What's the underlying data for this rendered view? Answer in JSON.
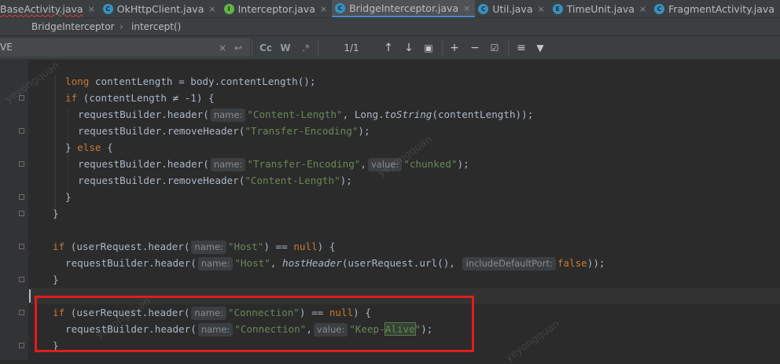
{
  "tabs": [
    {
      "name": "BaseActivity.java",
      "icon": "",
      "close": "×",
      "error": true
    },
    {
      "name": "OkHttpClient.java",
      "icon": "C",
      "iconColor": "#3592c4",
      "close": "×"
    },
    {
      "name": "Interceptor.java",
      "icon": "I",
      "iconColor": "#62b543",
      "close": "×"
    },
    {
      "name": "BridgeInterceptor.java",
      "icon": "C",
      "iconColor": "#3592c4",
      "close": "×",
      "active": true
    },
    {
      "name": "Util.java",
      "icon": "C",
      "iconColor": "#3592c4",
      "close": "×"
    },
    {
      "name": "TimeUnit.java",
      "icon": "E",
      "iconColor": "#3592c4",
      "close": "×"
    },
    {
      "name": "FragmentActivity.java",
      "icon": "C",
      "iconColor": "#3592c4",
      "close": "×"
    }
  ],
  "breadcrumb": {
    "class_name": "BridgeInterceptor",
    "separator": "›",
    "method": "intercept()"
  },
  "search": {
    "query": "VE",
    "clear_icon": "×",
    "history_icon": "↩",
    "match_case": "Cc",
    "whole_words": "W",
    "regex": ".*",
    "match_count": "1/1",
    "prev_icon": "↑",
    "next_icon": "↓",
    "select_all_icon": "▣",
    "add_occurrence_icon": "+",
    "remove_occurrence_icon": "−",
    "toggle_selection_icon": "☑",
    "multiline_icon": "≡",
    "filter_icon": "▼"
  },
  "code": {
    "l1": {
      "kw": "long",
      "rest": " contentLength = body.contentLength();"
    },
    "l2": {
      "kw": "if",
      "rest1": " (contentLength ≠ -1) {"
    },
    "l3": {
      "pre": "requestBuilder.header(",
      "hint": "name:",
      "str": "\"Content-Length\"",
      "mid": ", Long.",
      "fn": "toString",
      "post": "(contentLength));"
    },
    "l4": {
      "pre": "requestBuilder.removeHeader(",
      "str": "\"Transfer-Encoding\"",
      "post": ");"
    },
    "l5": {
      "pre": "} ",
      "kw": "else",
      "post": " {"
    },
    "l6": {
      "pre": "requestBuilder.header(",
      "hint1": "name:",
      "str1": "\"Transfer-Encoding\"",
      "comma": ",",
      "hint2": "value:",
      "str2": "\"chunked\"",
      "post": ");"
    },
    "l7": {
      "pre": "requestBuilder.removeHeader(",
      "str": "\"Content-Length\"",
      "post": ");"
    },
    "l8": {
      "text": "}"
    },
    "l9": {
      "text": "}"
    },
    "l10": {
      "kw": "if",
      "pre": " (userRequest.header(",
      "hint": "name:",
      "str": "\"Host\"",
      "mid": ") == ",
      "kw2": "null",
      "post": ") {"
    },
    "l11": {
      "pre": "requestBuilder.header(",
      "hint1": "name:",
      "str1": "\"Host\"",
      "mid": ", ",
      "fn": "hostHeader",
      "mid2": "(userRequest.url(), ",
      "hint2": "includeDefaultPort:",
      "kw": "false",
      "post": "));"
    },
    "l12": {
      "text": "}"
    },
    "l13": {
      "kw": "if",
      "pre": " (userRequest.header(",
      "hint": "name:",
      "str": "\"Connection\"",
      "mid": ") == ",
      "kw2": "null",
      "post": ") {"
    },
    "l14": {
      "pre": "requestBuilder.header(",
      "hint1": "name:",
      "str1": "\"Connection\"",
      "comma": ",",
      "hint2": "value:",
      "str2a": "\"Keep-",
      "str2hl": "Alive",
      "str2b": "\"",
      "post": ");"
    },
    "l15": {
      "text": "}"
    }
  },
  "watermark": "yeyongquan",
  "colors": {
    "keyword": "#cc7832",
    "string": "#6a8759",
    "text": "#a9b7c6",
    "highlight_box": "#e01d1d",
    "active_tab_underline": "#4a88c7"
  }
}
